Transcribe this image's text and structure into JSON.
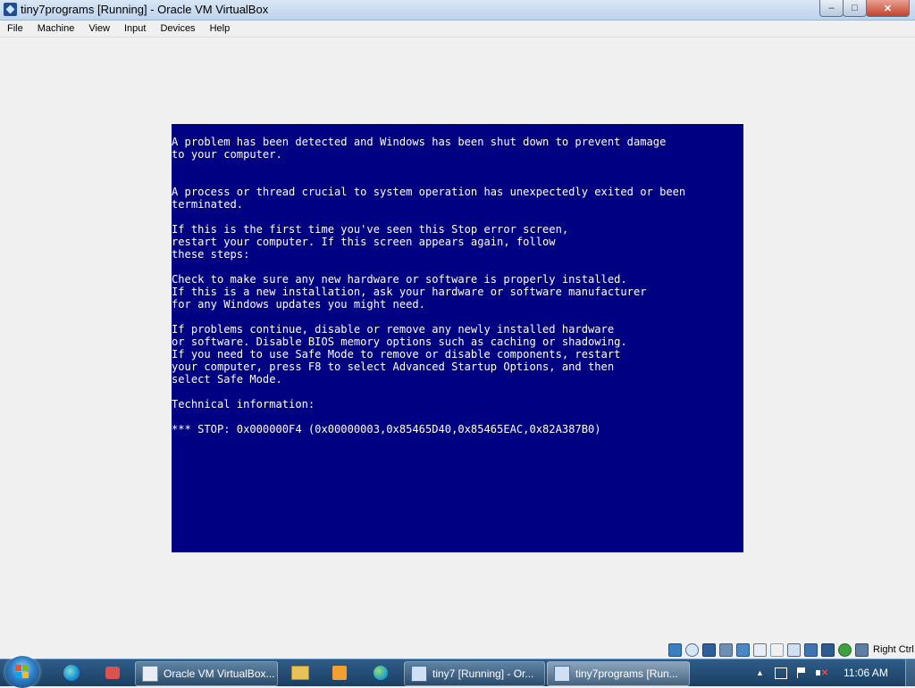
{
  "window": {
    "title": "tiny7programs [Running] - Oracle VM VirtualBox",
    "controls": {
      "minimize": "–",
      "maximize": "□",
      "close": "✕"
    }
  },
  "menu": [
    "File",
    "Machine",
    "View",
    "Input",
    "Devices",
    "Help"
  ],
  "bsod": {
    "lines": [
      "A problem has been detected and Windows has been shut down to prevent damage",
      "to your computer.",
      "",
      "",
      "A process or thread crucial to system operation has unexpectedly exited or been",
      "terminated.",
      "",
      "If this is the first time you've seen this Stop error screen,",
      "restart your computer. If this screen appears again, follow",
      "these steps:",
      "",
      "Check to make sure any new hardware or software is properly installed.",
      "If this is a new installation, ask your hardware or software manufacturer",
      "for any Windows updates you might need.",
      "",
      "If problems continue, disable or remove any newly installed hardware",
      "or software. Disable BIOS memory options such as caching or shadowing.",
      "If you need to use Safe Mode to remove or disable components, restart",
      "your computer, press F8 to select Advanced Startup Options, and then",
      "select Safe Mode.",
      "",
      "Technical information:",
      "",
      "*** STOP: 0x000000F4 (0x00000003,0x85465D40,0x85465EAC,0x82A387B0)"
    ]
  },
  "vm_status": {
    "icons": [
      "hard-disk-icon",
      "optical-drive-icon",
      "floppy-icon",
      "audio-icon",
      "network-icon",
      "usb-icon",
      "shared-folders-icon",
      "display-icon",
      "video-capture-icon",
      "cpu-icon",
      "mouse-integration-icon",
      "keyboard-icon"
    ],
    "host_key": "Right Ctrl"
  },
  "taskbar": {
    "tasks": [
      {
        "label": "Oracle VM VirtualBox...",
        "icon": "virtualbox-icon",
        "active": false
      },
      {
        "label": "tiny7 [Running] - Or...",
        "icon": "virtualbox-vm-icon",
        "active": false
      },
      {
        "label": "tiny7programs [Run...",
        "icon": "virtualbox-vm-icon",
        "active": true
      }
    ],
    "clock": "11:06 AM"
  },
  "colors": {
    "bsod_background": "#000082",
    "bsod_text": "#ffffff",
    "taskbar": "#244f77"
  }
}
